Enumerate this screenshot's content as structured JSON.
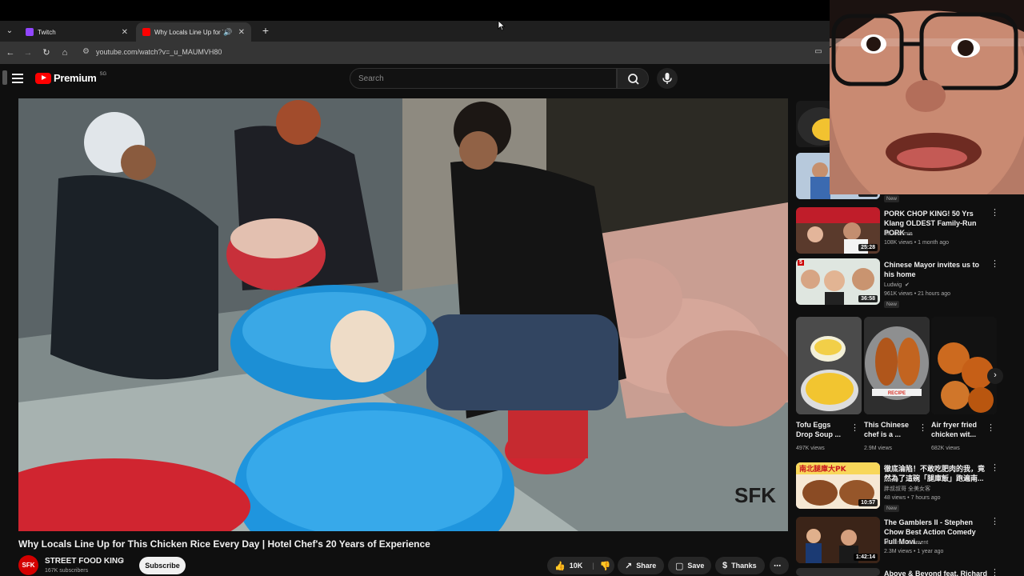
{
  "browser": {
    "tabs": [
      {
        "label": "Twitch",
        "fav_color": "#9146ff"
      },
      {
        "label": "Why Locals Line Up for This",
        "fav_color": "#ff0000"
      }
    ],
    "url": "youtube.com/watch?v=_u_MAUMVH80"
  },
  "header": {
    "logo": "Premium",
    "logo_badge": "SG",
    "search_placeholder": "Search"
  },
  "video": {
    "title": "Why Locals Line Up for This Chicken Rice Every Day | Hotel Chef's 20 Years of Experience",
    "channel": {
      "name": "STREET FOOD KING",
      "subscribers": "167K subscribers",
      "avatar": "SFK"
    },
    "subscribe_label": "Subscribe",
    "likes": "10K",
    "share_label": "Share",
    "save_label": "Save",
    "thanks_label": "Thanks",
    "watermark": "SFK"
  },
  "related": [
    {
      "duration": "34:12",
      "title": "",
      "channel": "",
      "meta": "",
      "badge": "New"
    },
    {
      "duration": "25:28",
      "title": "PORK CHOP KING! 50 Yrs Klang OLDEST Family-Run PORK ...",
      "channel": "So Yummie",
      "meta": "108K views • 1 month ago",
      "badge": ""
    },
    {
      "duration": "36:58",
      "rank": "5",
      "title": "Chinese Mayor invites us to his home",
      "channel": "Ludwig",
      "meta": "961K views • 21 hours ago",
      "badge": "New"
    },
    {
      "duration": "10:57",
      "title": "徹底淪陷！不敢吃肥肉的我，竟然為了這碗「腿庫飯」跑遍南...",
      "channel": "胖叔叔哥 全美女客",
      "meta": "48 views • 7 hours ago",
      "badge": "New"
    },
    {
      "duration": "1:42:14",
      "title": "The Gamblers II - Stephen Chow Best Action Comedy Full Movi...",
      "channel": "Mr. Entertainment",
      "meta": "2.3M views • 1 year ago",
      "badge": ""
    },
    {
      "duration": "",
      "title": "Above & Beyond feat. Richard",
      "channel": "",
      "meta": "",
      "badge": ""
    }
  ],
  "shorts": [
    {
      "title": "Tofu Eggs Drop Soup ...",
      "views": "497K views"
    },
    {
      "title": "This Chinese chef is a ...",
      "views": "2.9M views"
    },
    {
      "title": "Air fryer fried chicken wit...",
      "views": "682K views"
    }
  ],
  "thumb_texts": {
    "r4": "南北腿庫大PK",
    "short2": "RECIPE"
  }
}
